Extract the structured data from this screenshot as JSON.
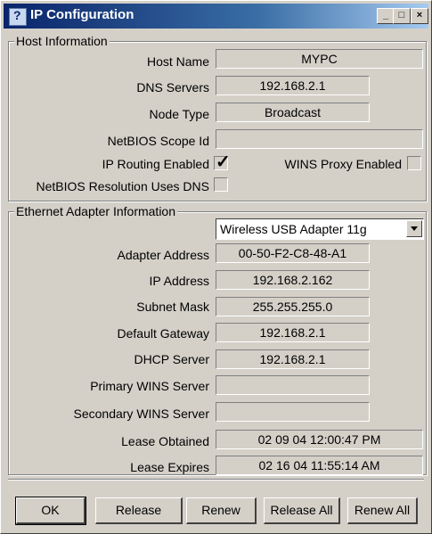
{
  "window": {
    "title": "IP Configuration"
  },
  "host_info": {
    "group_title": "Host Information",
    "host_name_label": "Host Name",
    "host_name": "MYPC",
    "dns_label": "DNS Servers",
    "dns": "192.168.2.1",
    "node_type_label": "Node Type",
    "node_type": "Broadcast",
    "scope_label": "NetBIOS Scope Id",
    "scope": "",
    "ip_routing_label": "IP Routing Enabled",
    "ip_routing_checked": true,
    "wins_proxy_label": "WINS Proxy Enabled",
    "wins_proxy_checked": false,
    "netbios_dns_label": "NetBIOS Resolution Uses DNS",
    "netbios_dns_checked": false
  },
  "adapter_info": {
    "group_title": "Ethernet  Adapter Information",
    "selected_adapter": "Wireless USB Adapter 11g",
    "rows": [
      {
        "label": "Adapter Address",
        "value": "00-50-F2-C8-48-A1"
      },
      {
        "label": "IP Address",
        "value": "192.168.2.162"
      },
      {
        "label": "Subnet Mask",
        "value": "255.255.255.0"
      },
      {
        "label": "Default Gateway",
        "value": "192.168.2.1"
      },
      {
        "label": "DHCP Server",
        "value": "192.168.2.1"
      },
      {
        "label": "Primary WINS Server",
        "value": ""
      },
      {
        "label": "Secondary WINS Server",
        "value": ""
      },
      {
        "label": "Lease Obtained",
        "value": "02 09 04 12:00:47 PM"
      },
      {
        "label": "Lease Expires",
        "value": "02 16 04 11:55:14 AM"
      }
    ]
  },
  "buttons": {
    "ok": "OK",
    "release": "Release",
    "renew": "Renew",
    "release_all": "Release All",
    "renew_all": "Renew All"
  },
  "icons": {
    "app": "network-config-icon",
    "minimize": "minimize-icon",
    "maximize": "maximize-icon",
    "close": "close-icon",
    "dropdown": "chevron-down-icon",
    "check": "checkmark-icon"
  },
  "colors": {
    "face": "#d4d0c8",
    "title_start": "#0a246a",
    "title_end": "#a6caf0"
  }
}
